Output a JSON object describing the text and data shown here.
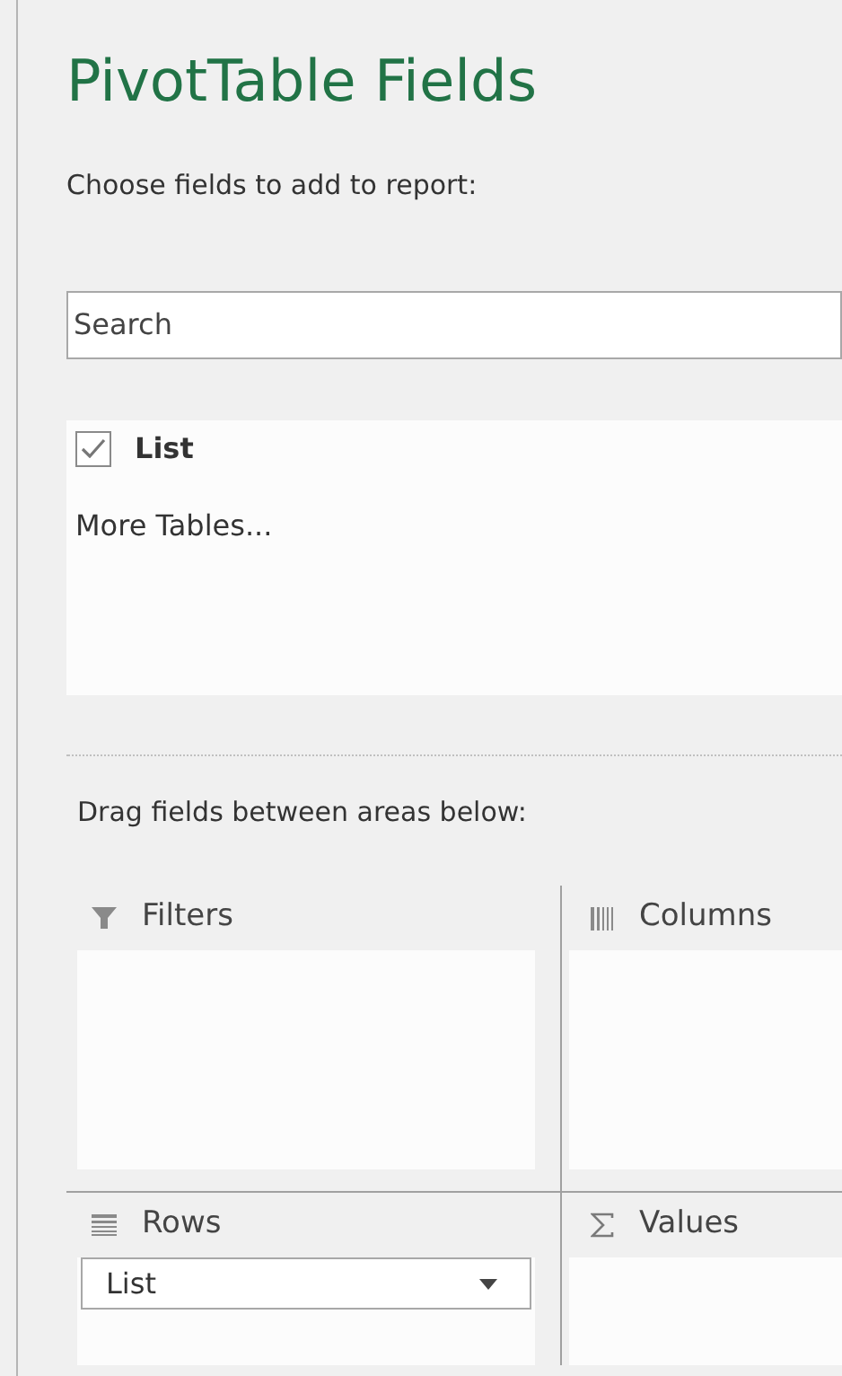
{
  "title": "PivotTable Fields",
  "choose_label": "Choose fields to add to report:",
  "search": {
    "placeholder": "Search"
  },
  "fields": [
    {
      "label": "List",
      "checked": true
    }
  ],
  "more_tables": "More Tables...",
  "drag_label": "Drag fields between areas below:",
  "areas": [
    {
      "kind": "filters",
      "label": "Filters"
    },
    {
      "kind": "columns",
      "label": "Columns"
    },
    {
      "kind": "rows",
      "label": "Rows",
      "items": [
        "List"
      ]
    },
    {
      "kind": "values",
      "label": "Values"
    }
  ]
}
